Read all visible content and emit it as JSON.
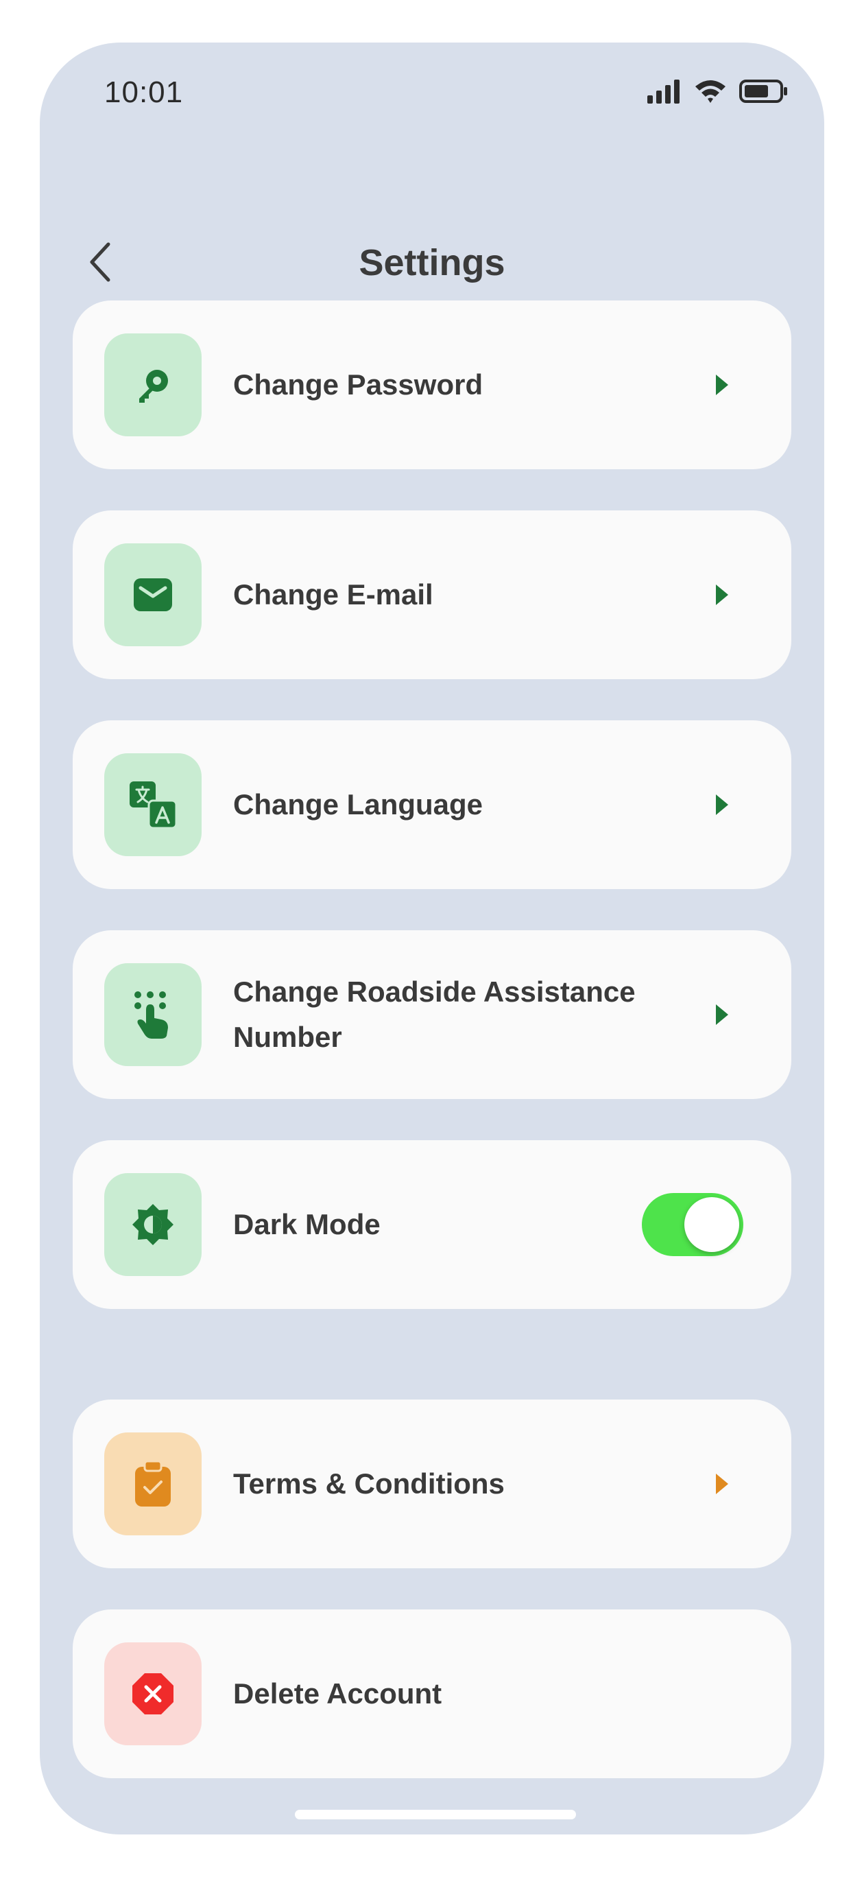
{
  "status_bar": {
    "time": "10:01",
    "icons": [
      "signal-icon",
      "wifi-icon",
      "battery-icon"
    ]
  },
  "header": {
    "title": "Settings",
    "back_icon": "chevron-left-icon"
  },
  "settings": [
    {
      "label": "Change Password",
      "icon": "key-icon",
      "accent": "#1f7a39",
      "tile": "#c9ecd2"
    },
    {
      "label": "Change E-mail",
      "icon": "mail-icon",
      "accent": "#1f7a39",
      "tile": "#c9ecd2"
    },
    {
      "label": "Change Language",
      "icon": "translate-icon",
      "accent": "#1f7a39",
      "tile": "#c9ecd2"
    },
    {
      "label": "Change Roadside Assistance Number",
      "icon": "dialpad-icon",
      "accent": "#1f7a39",
      "tile": "#c9ecd2"
    },
    {
      "label": "Dark Mode",
      "icon": "brightness-icon",
      "accent": "#1f7a39",
      "tile": "#c9ecd2",
      "toggle_on": true,
      "toggle_color": "#4ee34b"
    },
    {
      "label": "Terms & Conditions",
      "icon": "clipboard-check-icon",
      "accent": "#e08a1f",
      "tile": "#f9dcb3"
    },
    {
      "label": "Delete Account",
      "icon": "cancel-octagon-icon",
      "accent": "#f02b2b",
      "tile": "#fbd9d6"
    }
  ],
  "colors": {
    "background": "#d8dfeb",
    "card": "#fafafa",
    "text": "#3a3a3a"
  }
}
